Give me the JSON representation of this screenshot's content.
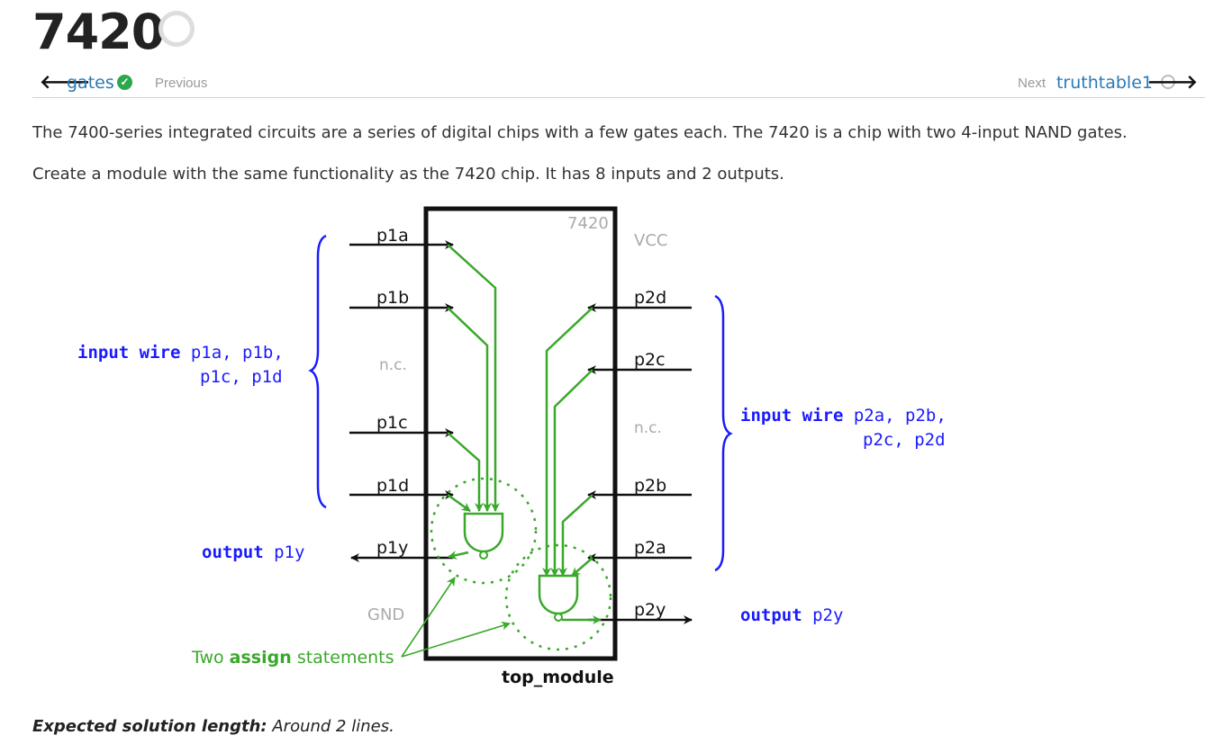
{
  "page": {
    "title": "7420"
  },
  "nav": {
    "previous_arrow": "🡐",
    "previous_link": "gates",
    "previous_label": "Previous",
    "next_label": "Next",
    "next_link": "truthtable1",
    "next_arrow": "🡒"
  },
  "content": {
    "paragraph1": "The 7400-series integrated circuits are a series of digital chips with a few gates each. The 7420 is a chip with two 4-input NAND gates.",
    "paragraph2": "Create a module with the same functionality as the 7420 chip. It has 8 inputs and 2 outputs."
  },
  "diagram": {
    "chip_label": "7420",
    "module_name": "top_module",
    "vcc": "VCC",
    "gnd": "GND",
    "nc": "n.c.",
    "pins_left": [
      "p1a",
      "p1b",
      "p1c",
      "p1d",
      "p1y"
    ],
    "pins_right": [
      "p2d",
      "p2c",
      "p2b",
      "p2a",
      "p2y"
    ],
    "left_input_keyword": "input wire",
    "left_input_names_line1": "p1a, p1b,",
    "left_input_names_line2": "p1c, p1d",
    "right_input_keyword": "input wire",
    "right_input_names_line1": "p2a, p2b,",
    "right_input_names_line2": "p2c, p2d",
    "left_output_keyword": "output",
    "left_output_name": "p1y",
    "right_output_keyword": "output",
    "right_output_name": "p2y",
    "assign_note_prefix": "Two",
    "assign_note_keyword": "assign",
    "assign_note_suffix": "statements",
    "colors": {
      "green": "#3aa82a",
      "blue": "#1a1aff",
      "gray": "#aaaaaa",
      "black": "#111111"
    }
  },
  "footer": {
    "expected_label": "Expected solution length:",
    "expected_value": "Around 2 lines."
  }
}
